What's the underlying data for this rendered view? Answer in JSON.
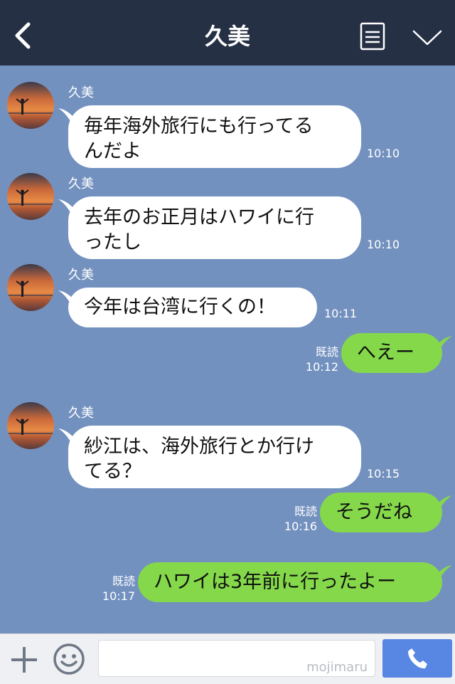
{
  "header": {
    "title": "久美",
    "back_icon": "chevron-left-icon",
    "menu_icon": "document-list-icon",
    "collapse_icon": "chevron-down-icon"
  },
  "messages": [
    {
      "sender": "久美",
      "text": "毎年海外旅行にも行ってる\nんだよ",
      "time": "10:10"
    },
    {
      "sender": "久美",
      "text": "去年のお正月はハワイに行\nったし",
      "time": "10:10"
    },
    {
      "sender": "久美",
      "text": "今年は台湾に行くの！",
      "time": "10:11"
    },
    {
      "read": "既読",
      "text": "へえー",
      "time": "10:12"
    },
    {
      "sender": "久美",
      "text": "紗江は、海外旅行とか行け\nてる？",
      "time": "10:15"
    },
    {
      "read": "既読",
      "text": "そうだね",
      "time": "10:16"
    },
    {
      "read": "既読",
      "text": "ハワイは3年前に行ったよー",
      "time": "10:17"
    }
  ],
  "footer": {
    "watermark": "mojimaru",
    "input_placeholder": "",
    "plus_icon": "plus-icon",
    "emoji_icon": "smiley-icon",
    "call_icon": "phone-icon"
  },
  "colors": {
    "background": "#7391bf",
    "header": "#263045",
    "incoming_bubble": "#ffffff",
    "outgoing_bubble": "#84d84a",
    "call_button": "#5887e3"
  }
}
